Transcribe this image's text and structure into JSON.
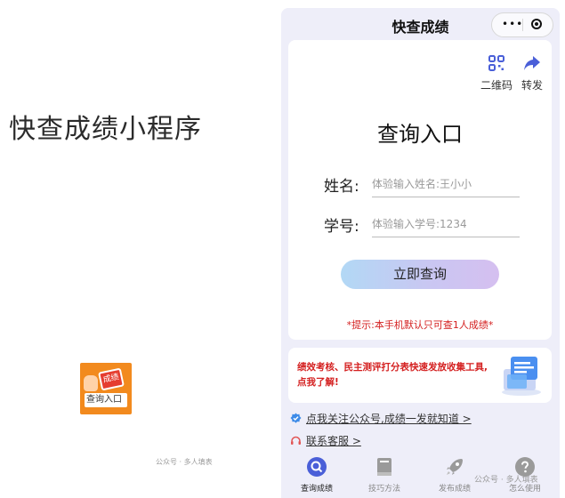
{
  "left_panel": {
    "title": "快查成绩小程序",
    "icon_badge": "成绩",
    "icon_caption": "查询入口",
    "watermark": "公众号 · 多人填表"
  },
  "nav": {
    "title": "快查成绩",
    "menu_dots": "•••"
  },
  "tools": {
    "qr_label": "二维码",
    "share_label": "转发"
  },
  "form": {
    "title": "查询入口",
    "name_label": "姓名:",
    "name_placeholder": "体验输入姓名:王小小",
    "id_label": "学号:",
    "id_placeholder": "体验输入学号:1234",
    "submit_label": "立即查询",
    "tip": "*提示:本手机默认只可查1人成绩*"
  },
  "ad": {
    "line1": "绩效考核、民主测评打分表快速发放收集工具,",
    "line2": "点我了解!"
  },
  "links": {
    "follow": "点我关注公众号,成绩一发就知道 >",
    "service": "联系客服 >"
  },
  "tabbar": {
    "tabs": [
      {
        "label": "查询成绩",
        "icon": "search-icon",
        "active": true
      },
      {
        "label": "技巧方法",
        "icon": "book-icon",
        "active": false
      },
      {
        "label": "发布成绩",
        "icon": "rocket-icon",
        "active": false
      },
      {
        "label": "怎么使用",
        "icon": "question-icon",
        "active": false
      }
    ],
    "watermark": "公众号 · 多人填表"
  },
  "colors": {
    "accent": "#4a5fd8",
    "tip_red": "#d42020",
    "page_bg": "#eeeef9",
    "icon_orange": "#f28a1e"
  }
}
